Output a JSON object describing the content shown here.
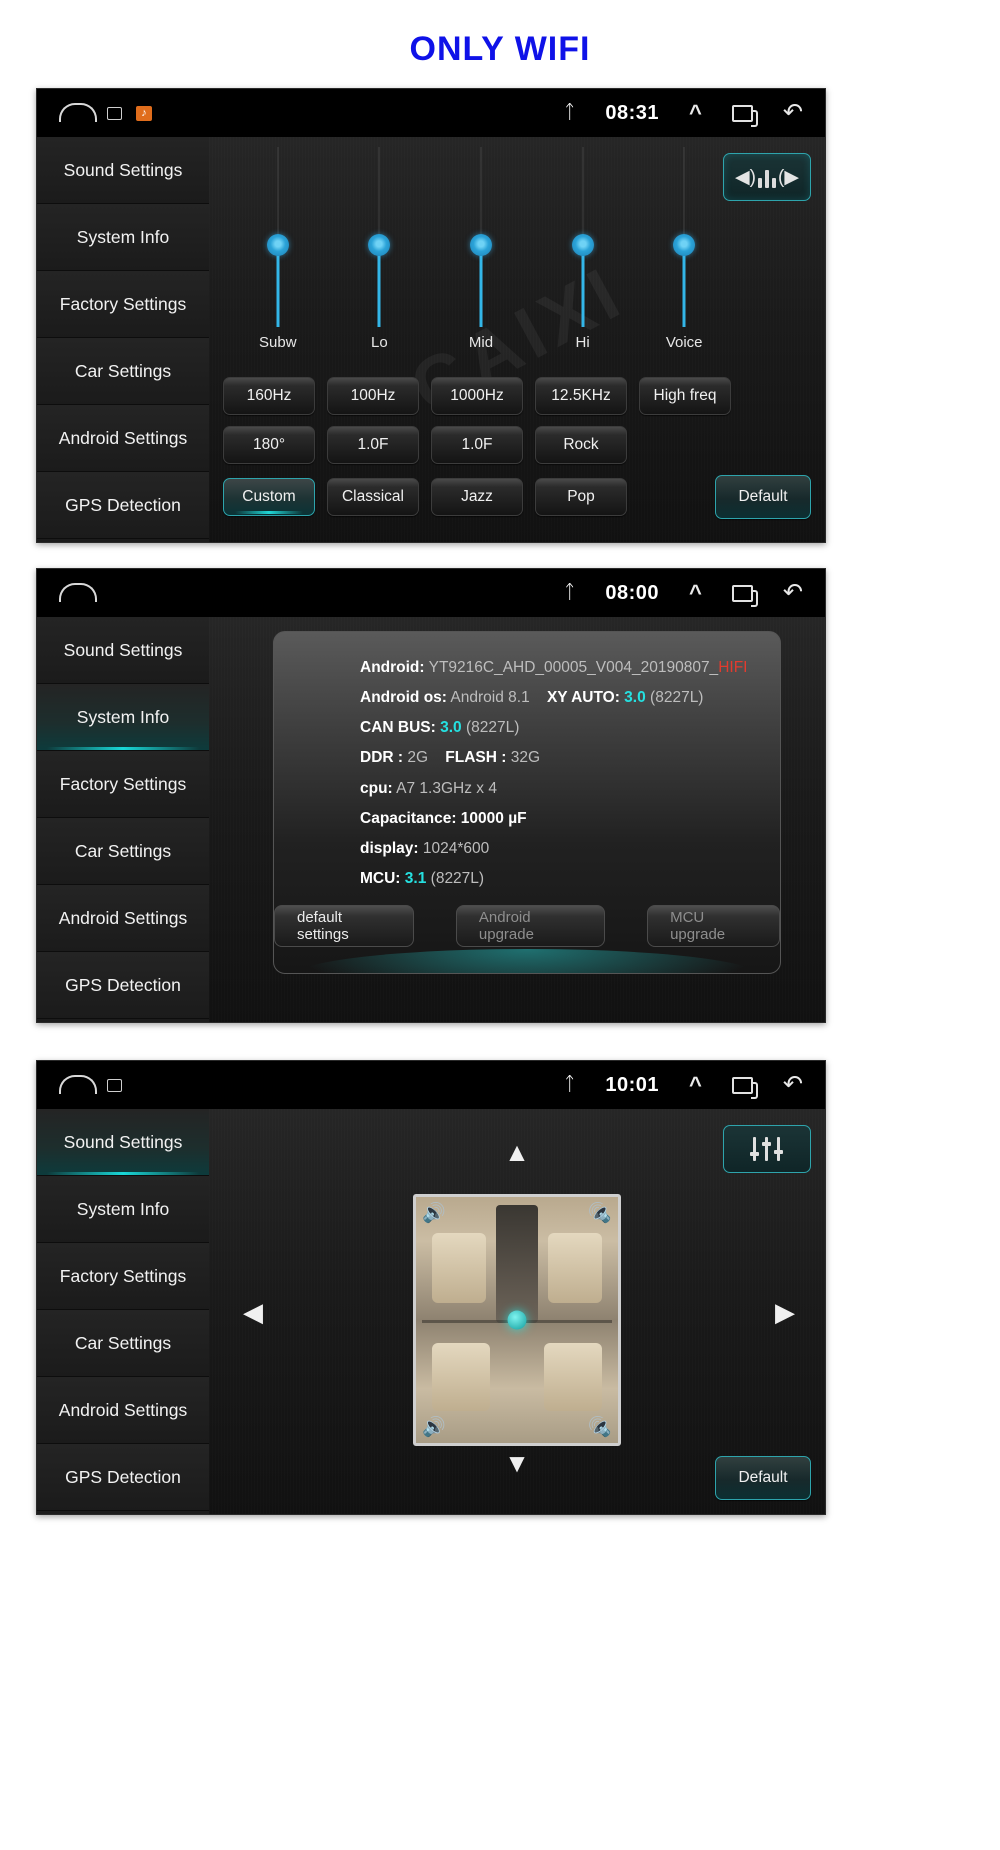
{
  "page": {
    "title": "ONLY WIFI",
    "title_color": "#0f12e8",
    "watermark": "CAIXI"
  },
  "sidebar": {
    "items": [
      {
        "label": "Sound Settings"
      },
      {
        "label": "System Info"
      },
      {
        "label": "Factory Settings"
      },
      {
        "label": "Car Settings"
      },
      {
        "label": "Android Settings"
      },
      {
        "label": "GPS Detection"
      }
    ]
  },
  "panels": [
    {
      "id": "equalizer",
      "statusbar": {
        "time": "08:31",
        "bluetooth": "bluetooth-icon",
        "home": "home-icon",
        "recents": "recents-icon",
        "back": "back-icon",
        "expand": "chevron-up-icon"
      },
      "active_sidebar_index": -1,
      "sliders": [
        {
          "label": "Subw",
          "value": 52
        },
        {
          "label": "Lo",
          "value": 52
        },
        {
          "label": "Mid",
          "value": 52
        },
        {
          "label": "Hi",
          "value": 52
        },
        {
          "label": "Voice",
          "value": 52
        }
      ],
      "rows": [
        [
          "160Hz",
          "100Hz",
          "1000Hz",
          "12.5KHz",
          "High freq"
        ],
        [
          "180°",
          "1.0F",
          "1.0F",
          "Rock"
        ],
        [
          "Custom",
          "Classical",
          "Jazz",
          "Pop"
        ]
      ],
      "selected_preset": "Custom",
      "default_label": "Default",
      "corner_icon": "speaker-balance-icon"
    },
    {
      "id": "system-info",
      "statusbar": {
        "time": "08:00"
      },
      "active_sidebar_index": 1,
      "info": [
        {
          "key": "Android:",
          "value": "YT9216C_AHD_00005_V004_20190807_",
          "suffix_red": "HIFI"
        },
        {
          "key": "Android os:",
          "value": "Android 8.1",
          "key2": "XY AUTO:",
          "value2_cyan": "3.0",
          "value2_gray": "(8227L)"
        },
        {
          "key": "CAN BUS:",
          "value_cyan": "3.0",
          "value_gray": "(8227L)"
        },
        {
          "key": "DDR :",
          "value": "2G",
          "key2": "FLASH :",
          "value2": "32G"
        },
        {
          "key": "cpu:",
          "value": "A7 1.3GHz x 4"
        },
        {
          "key": "Capacitance:",
          "value_white": "10000 µF"
        },
        {
          "key": "display:",
          "value": "1024*600"
        },
        {
          "key": "MCU:",
          "value_cyan": "3.1",
          "value_gray": "(8227L)"
        }
      ],
      "buttons": [
        {
          "label": "default settings",
          "dim": false
        },
        {
          "label": "Android upgrade",
          "dim": true
        },
        {
          "label": "MCU upgrade",
          "dim": true
        }
      ]
    },
    {
      "id": "sound-position",
      "statusbar": {
        "time": "10:01"
      },
      "active_sidebar_index": 0,
      "arrows": {
        "up": "▲",
        "down": "▼",
        "left": "◀",
        "right": "▶"
      },
      "default_label": "Default",
      "corner_icon": "equalizer-sliders-icon",
      "car_image": "car-seats-top-view"
    }
  ]
}
